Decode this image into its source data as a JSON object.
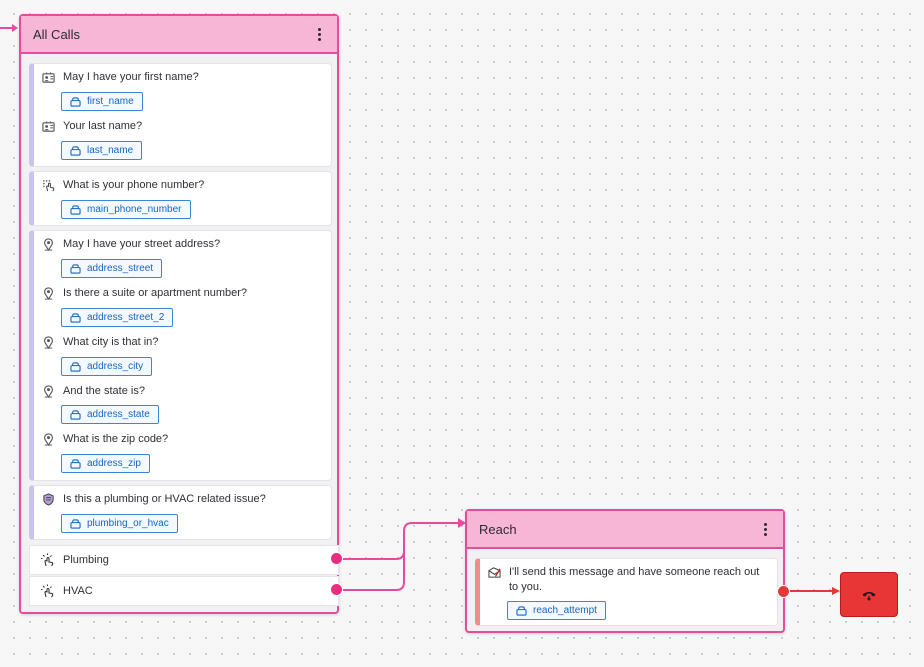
{
  "colors": {
    "node_border": "#e64c9c",
    "node_header": "#f8b6d6",
    "field_tag": "#1565c0",
    "hangup": "#e83535"
  },
  "nodes": {
    "all_calls": {
      "title": "All Calls",
      "groups": [
        {
          "questions": [
            {
              "text": "May I have your first name?",
              "icon": "contact-card-icon",
              "field": "first_name"
            },
            {
              "text": "Your last name?",
              "icon": "contact-card-icon",
              "field": "last_name"
            }
          ]
        },
        {
          "questions": [
            {
              "text": "What is your phone number?",
              "icon": "keypad-tap-icon",
              "field": "main_phone_number"
            }
          ]
        },
        {
          "questions": [
            {
              "text": "May I have your street address?",
              "icon": "map-pin-icon",
              "field": "address_street"
            },
            {
              "text": "Is there a suite or apartment number?",
              "icon": "map-pin-icon",
              "field": "address_street_2"
            },
            {
              "text": "What city is that in?",
              "icon": "map-pin-icon",
              "field": "address_city"
            },
            {
              "text": "And the state is?",
              "icon": "map-pin-icon",
              "field": "address_state"
            },
            {
              "text": "What is the zip code?",
              "icon": "map-pin-icon",
              "field": "address_zip"
            }
          ]
        },
        {
          "questions": [
            {
              "text": "Is this a plumbing or HVAC related issue?",
              "icon": "choice-shield-icon",
              "field": "plumbing_or_hvac"
            }
          ]
        }
      ],
      "branches": [
        "Plumbing",
        "HVAC"
      ]
    },
    "reach": {
      "title": "Reach",
      "message": {
        "text_line1": "I'll send this message and have someone reach out",
        "text_line2": "to you.",
        "icon": "message-edit-icon",
        "field": "reach_attempt"
      }
    },
    "end_call": {
      "icon": "phone-hangup-icon"
    }
  }
}
